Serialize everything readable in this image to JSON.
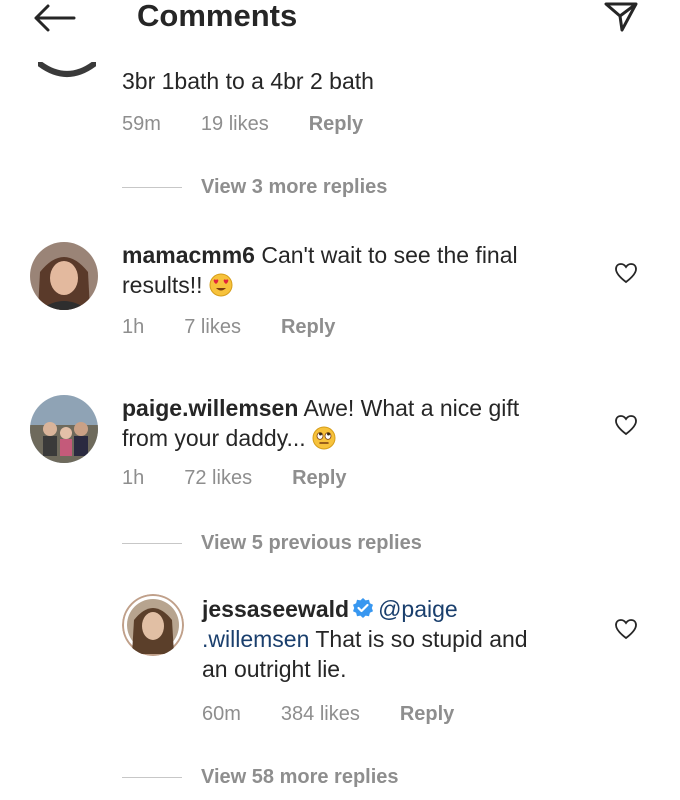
{
  "header": {
    "title": "Comments",
    "back_icon": "arrow-left-icon",
    "send_icon": "paper-plane-icon"
  },
  "comments": [
    {
      "id": "c0",
      "text": "3br 1bath to a 4br 2 bath",
      "time": "59m",
      "likes": "19 likes",
      "reply": "Reply",
      "view_replies": "View 3 more replies"
    },
    {
      "id": "c1",
      "username": "mamacmm6",
      "text_line1": " Can't wait to see the final",
      "text_line2": "results!!",
      "emoji": "heart-eyes-emoji",
      "time": "1h",
      "likes": "7 likes",
      "reply": "Reply"
    },
    {
      "id": "c2",
      "username": "paige.willemsen",
      "text_line1": " Awe! What a nice gift",
      "text_line2": "from your daddy...",
      "emoji": "eye-roll-emoji",
      "time": "1h",
      "likes": "72 likes",
      "reply": "Reply",
      "view_replies": "View 5 previous replies"
    },
    {
      "id": "c3",
      "username": "jessaseewald",
      "verified_icon": "verified-badge-icon",
      "mention_part1": "@paige",
      "mention_part2": ".willemsen",
      "text_line2_rest": " That is so stupid and",
      "text_line3": "an outright lie.",
      "time": "60m",
      "likes": "384 likes",
      "reply": "Reply",
      "view_replies": "View 58 more replies"
    }
  ],
  "colors": {
    "text": "#262626",
    "meta": "#8e8e8e",
    "mention": "#1a3f6d",
    "verified": "#3897f0"
  }
}
